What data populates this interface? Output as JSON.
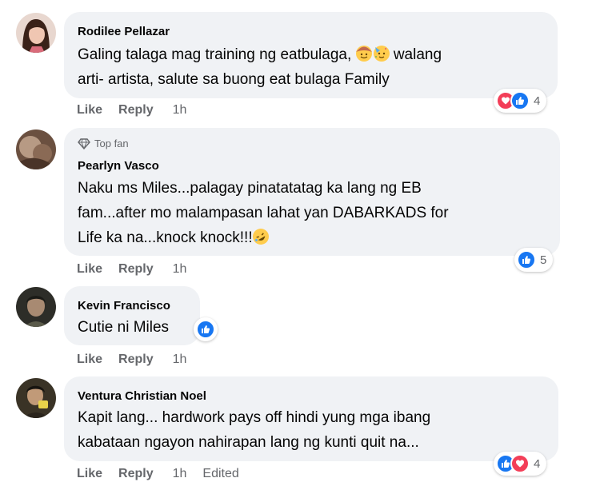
{
  "comments": [
    {
      "author": "Rodilee Pellazar",
      "lines": [
        "Galing talaga mag training ng eatbulaga,",
        "arti- artista, salute sa buong eat bulaga Family"
      ],
      "line1_after_emoji": "walang",
      "emojis": [
        "cowboy-face-emoji",
        "partying-face-emoji"
      ],
      "actions": {
        "like": "Like",
        "reply": "Reply",
        "time": "1h"
      },
      "reactions": {
        "icons": [
          "love",
          "like"
        ],
        "count": "4"
      },
      "avatar_color": "#c99a86"
    },
    {
      "badge": "Top fan",
      "author": "Pearlyn Vasco",
      "lines": [
        "Naku ms Miles...palagay pinatatatag ka lang ng EB",
        "fam...after mo malampasan lahat yan DABARKADS for",
        "Life ka na...knock knock!!!"
      ],
      "emojis": [
        "rolling-on-floor-laughing-emoji"
      ],
      "actions": {
        "like": "Like",
        "reply": "Reply",
        "time": "1h"
      },
      "reactions": {
        "icons": [
          "like"
        ],
        "count": "5"
      },
      "avatar_color": "#7a5e4a"
    },
    {
      "author": "Kevin Francisco",
      "lines": [
        "Cutie ni Miles"
      ],
      "actions": {
        "like": "Like",
        "reply": "Reply",
        "time": "1h"
      },
      "reactions": {
        "icons": [
          "like"
        ],
        "count": ""
      },
      "avatar_color": "#3b3b35"
    },
    {
      "author": "Ventura Christian Noel",
      "lines": [
        "Kapit lang... hardwork pays off hindi yung mga ibang",
        "kabataan ngayon nahirapan lang ng kunti quit na..."
      ],
      "actions": {
        "like": "Like",
        "reply": "Reply",
        "time": "1h",
        "edited": "Edited"
      },
      "reactions": {
        "icons": [
          "like",
          "love"
        ],
        "count": "4"
      },
      "avatar_color": "#4a4030"
    }
  ],
  "colors": {
    "bubble": "#f0f2f5",
    "secondary_text": "#65676b",
    "like_blue": "#1877f2",
    "love_red": "#f33e58"
  }
}
